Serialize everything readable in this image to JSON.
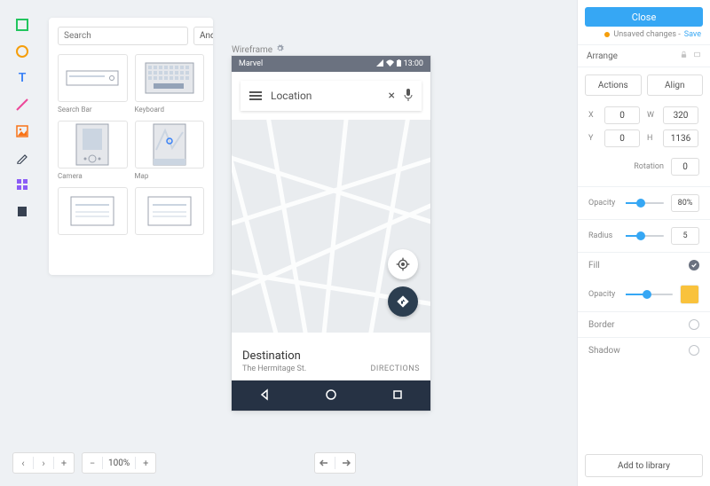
{
  "toolbar": {
    "tools": [
      "rect",
      "circle",
      "text",
      "line",
      "image",
      "pen",
      "grid",
      "artboard"
    ]
  },
  "library": {
    "search_placeholder": "Search",
    "platform": "Android",
    "items": [
      {
        "label": "Search Bar",
        "kind": "searchbar"
      },
      {
        "label": "Keyboard",
        "kind": "keyboard"
      },
      {
        "label": "Camera",
        "kind": "camera"
      },
      {
        "label": "Map",
        "kind": "map"
      },
      {
        "label": "",
        "kind": "blank"
      },
      {
        "label": "",
        "kind": "blank"
      }
    ]
  },
  "canvas": {
    "artboard_label": "Wireframe",
    "statusbar": {
      "title": "Marvel",
      "time": "13:00"
    },
    "search": {
      "value": "Location"
    },
    "destination": {
      "title": "Destination",
      "subtitle": "The Hermitage St.",
      "directions_label": "DIRECTIONS"
    }
  },
  "inspector": {
    "close_label": "Close",
    "unsaved_text": "Unsaved changes -",
    "save_label": "Save",
    "arrange_label": "Arrange",
    "actions_label": "Actions",
    "align_label": "Align",
    "x_label": "X",
    "x_value": "0",
    "y_label": "Y",
    "y_value": "0",
    "w_label": "W",
    "w_value": "320",
    "h_label": "H",
    "h_value": "1136",
    "rotation_label": "Rotation",
    "rotation_value": "0",
    "opacity_label": "Opacity",
    "opacity_value": "80%",
    "radius_label": "Radius",
    "radius_value": "5",
    "fill_label": "Fill",
    "fill_opacity_label": "Opacity",
    "fill_swatch": "#f9c23c",
    "border_label": "Border",
    "shadow_label": "Shadow",
    "add_library_label": "Add to library"
  },
  "footer": {
    "zoom": "100%"
  }
}
